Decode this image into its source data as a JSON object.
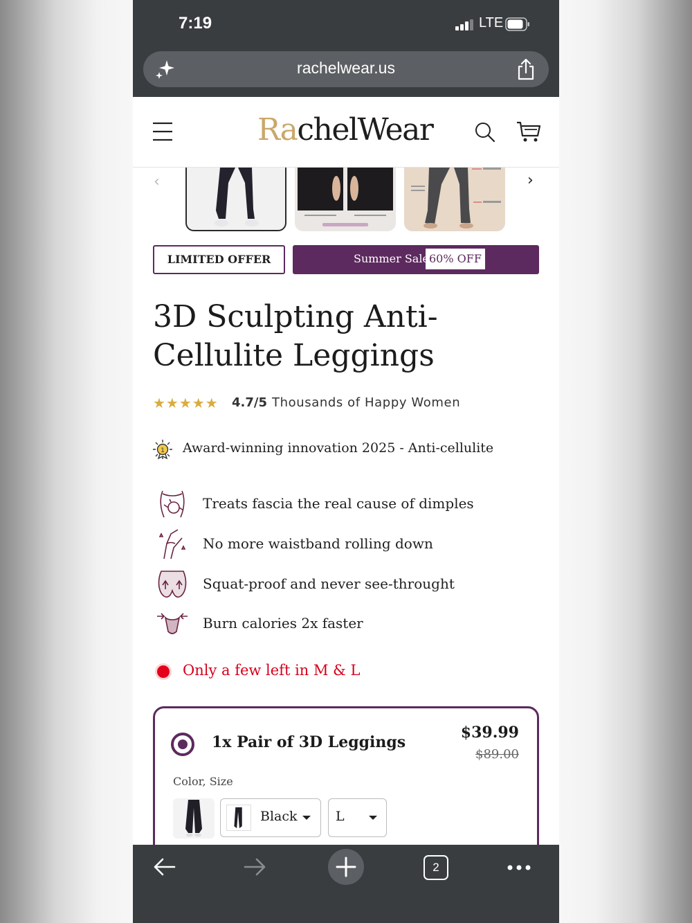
{
  "status_bar": {
    "time": "7:19",
    "network": "LTE"
  },
  "browser": {
    "url": "rachelwear.us",
    "tab_count": "2"
  },
  "site_header": {
    "logo_accent": "Ra",
    "logo_rest": "chelWear"
  },
  "offer": {
    "limited_label": "LIMITED OFFER",
    "sale_label": "Summer Sale",
    "sale_badge": "60% OFF"
  },
  "product": {
    "title": "3D Sculpting Anti-Cellulite Leggings",
    "stars": "★★★★★",
    "rating": "4.7/5",
    "rating_text": "Thousands of Happy Women",
    "award": "Award-winning innovation 2025 - Anti-cellulite",
    "benefits": [
      {
        "text": "Treats fascia the real cause of dimples",
        "icon": "fascia-icon"
      },
      {
        "text": "No more waistband rolling down",
        "icon": "waistband-icon"
      },
      {
        "text": "Squat-proof and never see-throught",
        "icon": "squat-proof-icon"
      },
      {
        "text": "Burn calories 2x faster",
        "icon": "burn-calories-icon"
      }
    ],
    "stock": "Only a few left in M & L"
  },
  "bundle": {
    "title": "1x Pair of 3D Leggings",
    "price": "$39.99",
    "old_price": "$89.00",
    "variant_label": "Color, Size",
    "color": "Black",
    "size": "L"
  },
  "colors": {
    "brand_purple": "#5c2a5e",
    "logo_gold": "#c9a86a",
    "star_gold": "#d9ac3f",
    "stock_red": "#d6001c",
    "chrome_dark": "#3a3d40"
  }
}
